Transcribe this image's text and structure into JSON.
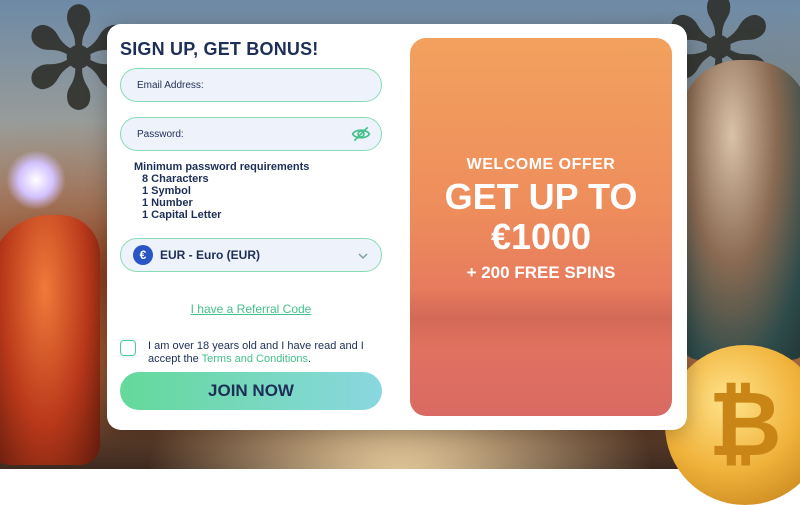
{
  "form": {
    "title": "SIGN UP, GET BONUS!",
    "email_placeholder": "Email Address:",
    "password_placeholder": "Password:",
    "requirements_title": "Minimum password requirements",
    "requirements": [
      "8 Characters",
      "1 Symbol",
      "1 Number",
      "1 Capital Letter"
    ],
    "currency_symbol": "€",
    "currency_label": "EUR - Euro (EUR)",
    "referral_link": "I have a Referral Code",
    "terms_text": "I am over 18 years old and I have read and I accept the",
    "terms_link": "Terms and Conditions",
    "terms_end": ".",
    "join_button": "JOIN NOW"
  },
  "offer": {
    "welcome": "WELCOME OFFER",
    "headline": "GET UP TO",
    "amount": "€1000",
    "spins": "+ 200 FREE SPINS"
  },
  "icons": {
    "password_toggle": "eye-slash-icon",
    "currency_dropdown": "chevron-down-icon",
    "currency_badge": "euro-icon"
  },
  "colors": {
    "accent_green": "#45c08a",
    "navy": "#1d2f57",
    "offer_orange": "#ee8d5c"
  }
}
